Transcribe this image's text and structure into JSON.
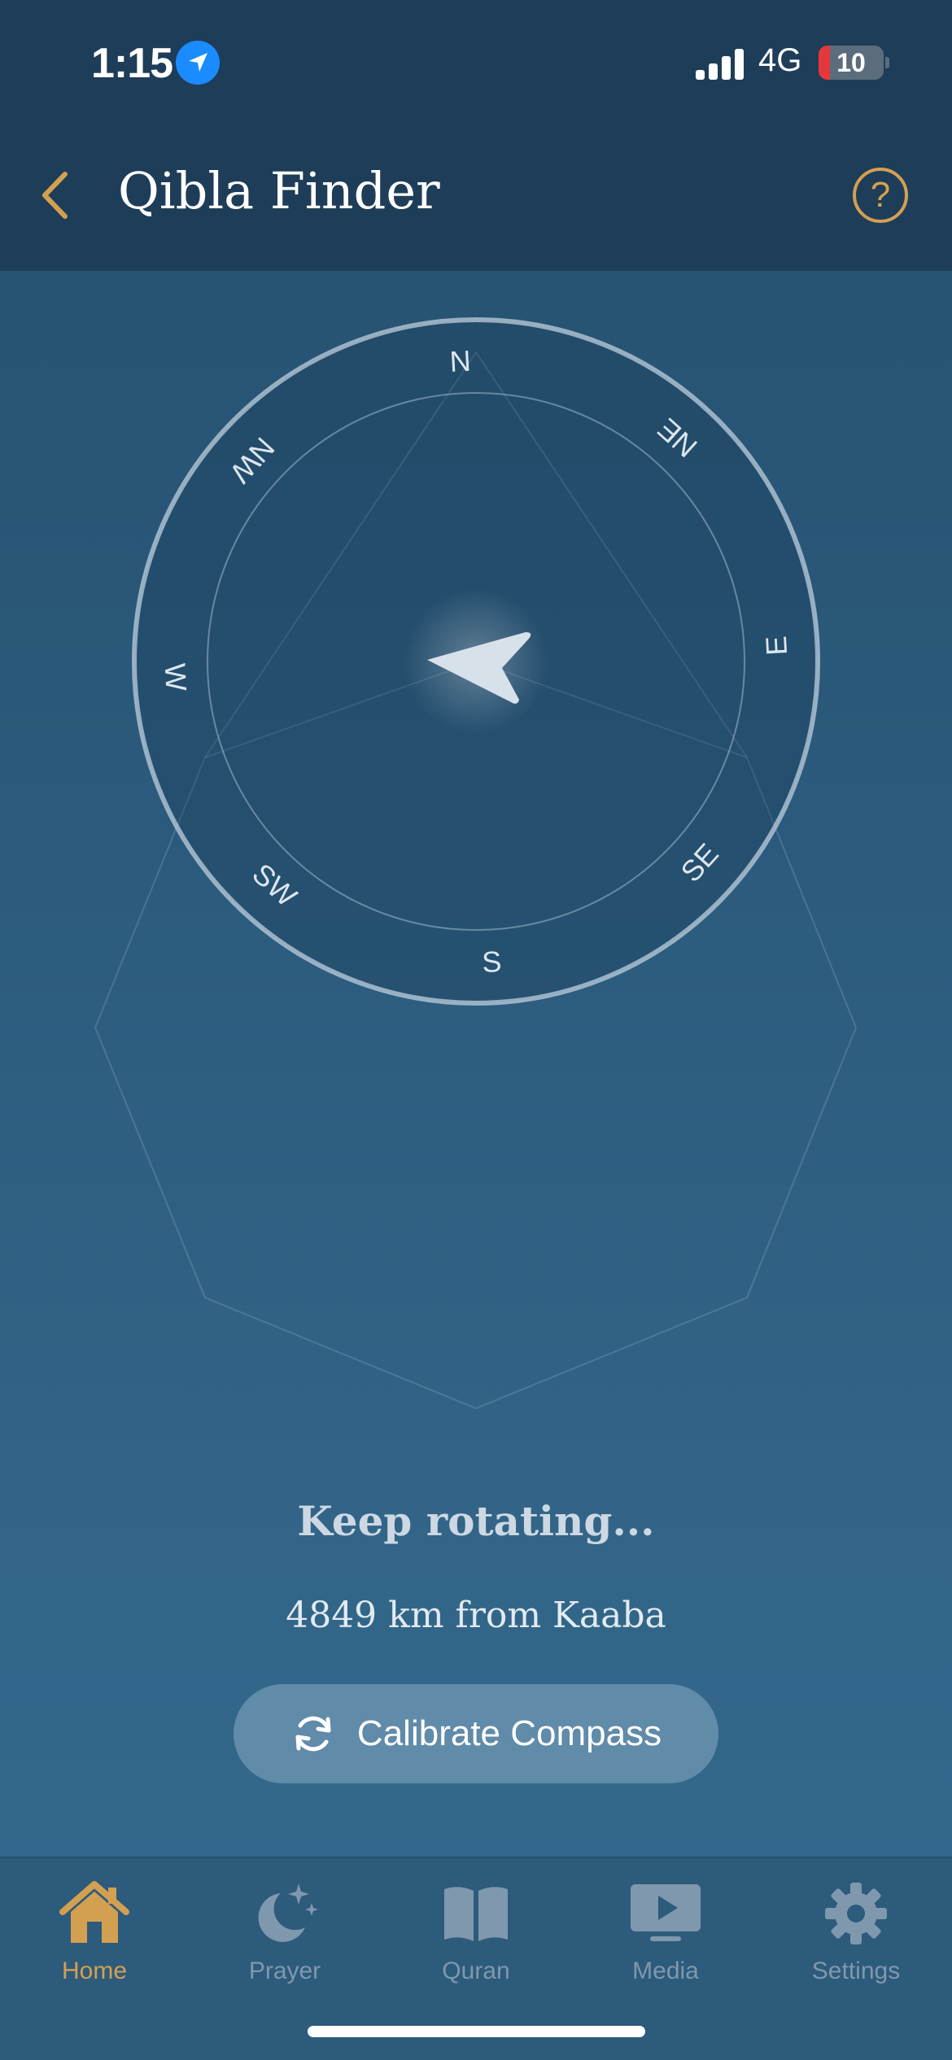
{
  "status_bar": {
    "time": "1:15",
    "network": "4G",
    "battery": "10",
    "signal_bars": 4
  },
  "header": {
    "title": "Qibla Finder",
    "back_icon": "chevron-left-icon",
    "help_icon": "question-circle-icon",
    "help_label": "?"
  },
  "compass": {
    "directions": [
      "N",
      "NE",
      "E",
      "SE",
      "S",
      "SW",
      "W",
      "NW"
    ]
  },
  "status_text": "Keep rotating...",
  "distance_text": "4849 km from Kaaba",
  "calibrate_button": {
    "label": "Calibrate Compass",
    "icon": "refresh-icon"
  },
  "tabs": [
    {
      "label": "Home",
      "icon": "home-icon",
      "active": true
    },
    {
      "label": "Prayer",
      "icon": "moon-star-icon",
      "active": false
    },
    {
      "label": "Quran",
      "icon": "book-icon",
      "active": false
    },
    {
      "label": "Media",
      "icon": "play-screen-icon",
      "active": false
    },
    {
      "label": "Settings",
      "icon": "gear-icon",
      "active": false
    }
  ],
  "colors": {
    "accent": "#d3a052",
    "header_bg": "#1e3d58",
    "inactive_tab": "#7f98ad"
  }
}
